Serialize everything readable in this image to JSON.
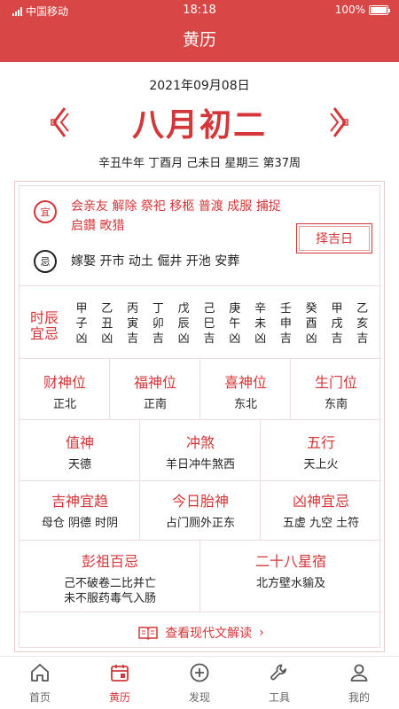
{
  "status": {
    "carrier": "中国移动",
    "time": "18:18",
    "battery": "100%"
  },
  "header": {
    "title": "黄历"
  },
  "date": {
    "gregorian": "2021年09月08日",
    "lunar": "八月初二",
    "ganzhi": "辛丑牛年  丁酉月  己未日  星期三  第37周"
  },
  "yi": {
    "badge": "宜",
    "line1": "会亲友 解除 祭祀 移柩 普渡 成服 捕捉",
    "line2": "启鑽 畋猎"
  },
  "ji": {
    "badge": "忌",
    "text": "嫁娶 开市 动土 倔井 开池 安葬"
  },
  "zeji_button": "择吉日",
  "shichen": {
    "title_line1": "时辰",
    "title_line2": "宜忌",
    "items": [
      {
        "stem": "甲",
        "branch": "子",
        "luck": "凶"
      },
      {
        "stem": "乙",
        "branch": "丑",
        "luck": "凶"
      },
      {
        "stem": "丙",
        "branch": "寅",
        "luck": "吉"
      },
      {
        "stem": "丁",
        "branch": "卯",
        "luck": "吉"
      },
      {
        "stem": "戊",
        "branch": "辰",
        "luck": "凶"
      },
      {
        "stem": "己",
        "branch": "巳",
        "luck": "吉"
      },
      {
        "stem": "庚",
        "branch": "午",
        "luck": "凶"
      },
      {
        "stem": "辛",
        "branch": "未",
        "luck": "凶"
      },
      {
        "stem": "壬",
        "branch": "申",
        "luck": "吉"
      },
      {
        "stem": "癸",
        "branch": "酉",
        "luck": "凶"
      },
      {
        "stem": "甲",
        "branch": "戌",
        "luck": "吉"
      },
      {
        "stem": "乙",
        "branch": "亥",
        "luck": "吉"
      }
    ]
  },
  "directions": [
    {
      "title": "财神位",
      "value": "正北"
    },
    {
      "title": "福神位",
      "value": "正南"
    },
    {
      "title": "喜神位",
      "value": "东北"
    },
    {
      "title": "生门位",
      "value": "东南"
    }
  ],
  "row2": [
    {
      "title": "值神",
      "value": "天德"
    },
    {
      "title": "冲煞",
      "value": "羊日冲牛煞西"
    },
    {
      "title": "五行",
      "value": "天上火"
    }
  ],
  "row3": [
    {
      "title": "吉神宜趋",
      "value": "母仓 阴德 时阴"
    },
    {
      "title": "今日胎神",
      "value": "占门厕外正东"
    },
    {
      "title": "凶神宜忌",
      "value": "五虚 九空 土符"
    }
  ],
  "row4": [
    {
      "title": "彭祖百忌",
      "line1": "己不破卷二比并亡",
      "line2": "未不服药毒气入肠"
    },
    {
      "title": "二十八星宿",
      "line1": "北方壁水貐及",
      "line2": ""
    }
  ],
  "read_more": "查看现代文解读",
  "tabs": [
    {
      "label": "首页",
      "icon": "home-icon"
    },
    {
      "label": "黄历",
      "icon": "calendar-icon"
    },
    {
      "label": "发现",
      "icon": "plus-circle-icon"
    },
    {
      "label": "工具",
      "icon": "wrench-icon"
    },
    {
      "label": "我的",
      "icon": "user-icon"
    }
  ],
  "colors": {
    "accent": "#d94646",
    "text_red": "#d4373a"
  }
}
